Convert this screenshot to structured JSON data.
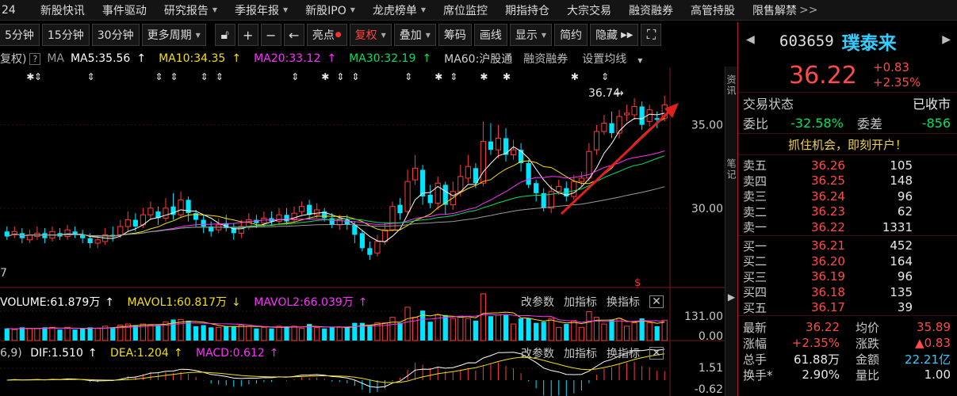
{
  "top_menu": {
    "first": "24",
    "items": [
      "新股快讯",
      "事件驱动",
      "研究报告",
      "季报年报",
      "新股IPO",
      "龙虎榜单",
      "席位监控",
      "期指持仓",
      "大宗交易",
      "融资融券",
      "高管持股",
      "限售解禁"
    ],
    "overflow": ">>"
  },
  "toolbar": {
    "periods": [
      "5分钟",
      "15分钟",
      "30分钟"
    ],
    "more_period": "更多周期",
    "liangdian": "亮点",
    "fuquan": "复权",
    "diejia": "叠加",
    "chouma": "筹码",
    "huaxian": "画线",
    "xianshi": "显示",
    "jianyue": "简约",
    "yincang": "隐藏"
  },
  "ma_legend": {
    "fuquan": "复权)",
    "help": "?",
    "ma": "MA",
    "ma5": "MA5:35.56",
    "ma10": "MA10:34.35",
    "ma20": "MA20:33.12",
    "ma30": "MA30:32.19",
    "ma60": "MA60:沪股通",
    "rzrq": "融资融券",
    "setting": "设置均线"
  },
  "colors": {
    "up": "#ff3b3b",
    "down": "#00e5ff",
    "ma5": "#ffffff",
    "ma10": "#f5e000",
    "ma20": "#ff30ff",
    "ma30": "#00e060",
    "ma60": "#9a9a9a",
    "accent_name": "#33ccff",
    "promo": "#f0d24a"
  },
  "chart_labels": {
    "high_label": "36.74",
    "left_low": "7",
    "y_ticks": [
      "35.00",
      "30.00"
    ],
    "vol_ticks": [
      "131.00",
      "0.00"
    ],
    "macd_ticks": [
      "1.51",
      "-0.62"
    ]
  },
  "vol_legend": {
    "volume": "VOLUME:61.879万",
    "mavol1": "MAVOL1:60.817万",
    "mavol2": "MAVOL2:66.039万",
    "gaicanshu": "改参数",
    "jiazhibiao": "加指标",
    "huanzhibiao": "换指标"
  },
  "macd_legend": {
    "params": "6,9)",
    "dif": "DIF:1.510",
    "dea": "DEA:1.204",
    "macd": "MACD:0.612",
    "gaicanshu": "改参数",
    "jiazhibiao": "加指标",
    "huanzhibiao": "换指标"
  },
  "side_strip": [
    "资",
    "讯",
    "笔",
    "记"
  ],
  "quote": {
    "code": "603659",
    "name": "璞泰来",
    "price": "36.22",
    "change": "+0.83",
    "change_pct": "+2.35%",
    "status_label": "交易状态",
    "status_value": "已收市",
    "weibi_label": "委比",
    "weibi_value": "-32.58%",
    "weicha_label": "委差",
    "weicha_value": "-856",
    "promo": "抓住机会，即刻开户！",
    "asks": [
      {
        "label": "卖五",
        "price": "36.26",
        "vol": "105"
      },
      {
        "label": "卖四",
        "price": "36.25",
        "vol": "148"
      },
      {
        "label": "卖三",
        "price": "36.24",
        "vol": "96"
      },
      {
        "label": "卖二",
        "price": "36.23",
        "vol": "62"
      },
      {
        "label": "卖一",
        "price": "36.22",
        "vol": "1331"
      }
    ],
    "bids": [
      {
        "label": "买一",
        "price": "36.21",
        "vol": "452"
      },
      {
        "label": "买二",
        "price": "36.20",
        "vol": "164"
      },
      {
        "label": "买三",
        "price": "36.19",
        "vol": "96"
      },
      {
        "label": "买四",
        "price": "36.18",
        "vol": "135"
      },
      {
        "label": "买五",
        "price": "36.17",
        "vol": "39"
      }
    ],
    "stats": [
      {
        "l1": "最新",
        "v1": "36.22",
        "l2": "均价",
        "v2": "35.89"
      },
      {
        "l1": "涨幅",
        "v1": "+2.35%",
        "l2": "涨跌",
        "v2": "▲0.83"
      },
      {
        "l1": "总手",
        "v1": "61.88万",
        "l2": "金额",
        "v2": "22.21亿"
      },
      {
        "l1": "换手*",
        "v1": "2.90%",
        "l2": "量比",
        "v2": "1.00"
      }
    ]
  },
  "chart_data": {
    "type": "candlestick",
    "ylim": [
      26.0,
      37.5
    ],
    "candles": [
      [
        28.6,
        28.3,
        28.9,
        28.1
      ],
      [
        28.4,
        28.6,
        28.9,
        28.2
      ],
      [
        28.5,
        28.2,
        28.8,
        27.9
      ],
      [
        28.1,
        28.4,
        28.7,
        27.9
      ],
      [
        28.3,
        28.5,
        28.9,
        28.1
      ],
      [
        28.5,
        28.2,
        28.8,
        27.9
      ],
      [
        28.2,
        28.6,
        28.9,
        28.0
      ],
      [
        28.5,
        28.3,
        28.8,
        28.1
      ],
      [
        28.3,
        28.7,
        29.0,
        28.1
      ],
      [
        28.6,
        28.4,
        28.9,
        28.2
      ],
      [
        28.4,
        28.2,
        28.7,
        27.9
      ],
      [
        28.2,
        27.9,
        28.5,
        27.6
      ],
      [
        27.9,
        28.1,
        28.4,
        27.6
      ],
      [
        28.0,
        28.4,
        28.8,
        27.8
      ],
      [
        28.4,
        28.3,
        28.9,
        28.0
      ],
      [
        28.4,
        28.9,
        29.3,
        28.2
      ],
      [
        28.9,
        29.3,
        29.8,
        28.6
      ],
      [
        29.3,
        28.9,
        29.7,
        28.6
      ],
      [
        29.0,
        29.6,
        30.0,
        28.8
      ],
      [
        29.6,
        30.0,
        30.4,
        29.3
      ],
      [
        29.8,
        29.4,
        30.1,
        29.0
      ],
      [
        29.4,
        30.0,
        30.6,
        29.2
      ],
      [
        30.1,
        29.6,
        30.9,
        29.3
      ],
      [
        29.6,
        30.5,
        31.0,
        29.4
      ],
      [
        30.5,
        29.7,
        30.7,
        29.2
      ],
      [
        29.7,
        29.3,
        29.9,
        28.9
      ],
      [
        29.3,
        28.9,
        29.6,
        28.5
      ],
      [
        28.9,
        28.6,
        29.2,
        28.3
      ],
      [
        28.7,
        29.0,
        29.4,
        28.5
      ],
      [
        29.1,
        28.8,
        29.6,
        28.6
      ],
      [
        28.8,
        28.5,
        29.1,
        28.1
      ],
      [
        28.5,
        28.9,
        29.3,
        28.2
      ],
      [
        28.9,
        29.3,
        29.7,
        28.7
      ],
      [
        29.3,
        29.1,
        29.6,
        28.8
      ],
      [
        29.1,
        29.4,
        29.8,
        28.9
      ],
      [
        29.4,
        29.2,
        29.8,
        29.0
      ],
      [
        29.2,
        29.6,
        30.0,
        29.0
      ],
      [
        29.6,
        29.2,
        30.0,
        29.0
      ],
      [
        29.3,
        29.7,
        30.1,
        29.1
      ],
      [
        29.8,
        30.1,
        30.4,
        29.6
      ],
      [
        30.2,
        29.6,
        30.5,
        29.3
      ],
      [
        29.6,
        29.9,
        30.3,
        29.4
      ],
      [
        29.8,
        29.4,
        30.0,
        29.2
      ],
      [
        29.4,
        29.0,
        29.7,
        28.8
      ],
      [
        29.0,
        29.3,
        29.6,
        28.7
      ],
      [
        29.3,
        29.0,
        29.6,
        28.7
      ],
      [
        29.0,
        28.4,
        29.2,
        27.9
      ],
      [
        28.5,
        27.6,
        28.7,
        27.4
      ],
      [
        27.6,
        27.2,
        28.0,
        26.9
      ],
      [
        27.3,
        28.0,
        28.4,
        27.1
      ],
      [
        28.0,
        28.7,
        29.1,
        27.8
      ],
      [
        28.7,
        30.1,
        30.4,
        28.6
      ],
      [
        30.2,
        29.7,
        30.6,
        29.3
      ],
      [
        29.8,
        31.6,
        32.3,
        29.6
      ],
      [
        31.7,
        32.4,
        33.2,
        31.4
      ],
      [
        32.3,
        30.7,
        32.6,
        30.2
      ],
      [
        30.8,
        30.3,
        31.4,
        30.0
      ],
      [
        30.3,
        31.5,
        31.9,
        29.9
      ],
      [
        31.4,
        30.2,
        31.6,
        29.6
      ],
      [
        30.2,
        31.0,
        31.6,
        29.9
      ],
      [
        31.0,
        31.9,
        32.6,
        30.7
      ],
      [
        31.8,
        32.5,
        33.2,
        31.5
      ],
      [
        32.4,
        31.5,
        32.7,
        31.2
      ],
      [
        31.5,
        34.0,
        35.2,
        31.3
      ],
      [
        34.0,
        33.5,
        35.1,
        33.2
      ],
      [
        33.5,
        34.2,
        35.0,
        33.0
      ],
      [
        34.2,
        33.2,
        34.8,
        32.8
      ],
      [
        33.2,
        33.5,
        34.1,
        32.9
      ],
      [
        33.5,
        32.7,
        33.9,
        32.2
      ],
      [
        32.7,
        31.4,
        32.9,
        31.2
      ],
      [
        31.5,
        30.9,
        31.7,
        30.4
      ],
      [
        30.9,
        30.0,
        31.2,
        29.8
      ],
      [
        30.0,
        31.0,
        31.4,
        29.7
      ],
      [
        31.0,
        31.3,
        31.7,
        30.8
      ],
      [
        31.2,
        30.7,
        31.6,
        30.4
      ],
      [
        30.7,
        31.6,
        32.0,
        30.5
      ],
      [
        31.6,
        31.8,
        32.2,
        31.3
      ],
      [
        31.8,
        33.4,
        33.9,
        31.6
      ],
      [
        33.5,
        34.6,
        35.0,
        33.2
      ],
      [
        34.6,
        35.1,
        35.6,
        34.4
      ],
      [
        35.1,
        34.5,
        35.8,
        34.2
      ],
      [
        34.5,
        35.5,
        35.9,
        34.2
      ],
      [
        35.6,
        35.7,
        36.2,
        35.2
      ],
      [
        35.6,
        36.1,
        36.6,
        35.3
      ],
      [
        36.1,
        35.0,
        36.4,
        34.7
      ],
      [
        35.2,
        35.9,
        36.2,
        34.9
      ],
      [
        35.4,
        35.3,
        35.8,
        34.8
      ],
      [
        35.4,
        36.2,
        36.74,
        35.2
      ]
    ]
  }
}
